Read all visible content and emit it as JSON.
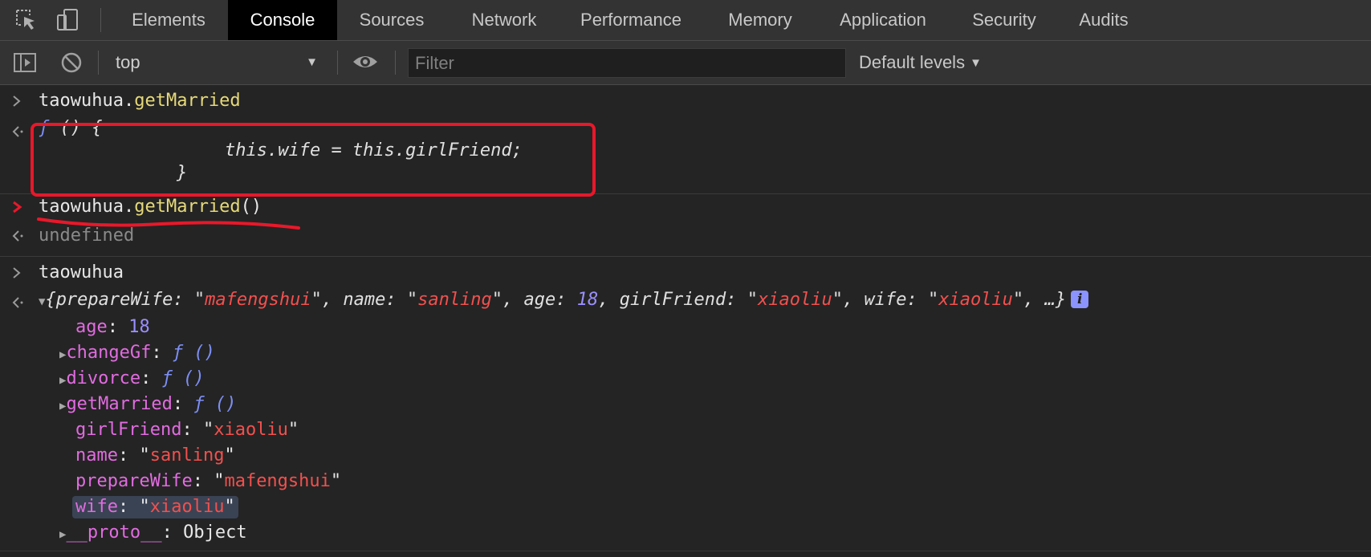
{
  "tabs": [
    {
      "label": "Elements",
      "active": false
    },
    {
      "label": "Console",
      "active": true
    },
    {
      "label": "Sources",
      "active": false
    },
    {
      "label": "Network",
      "active": false
    },
    {
      "label": "Performance",
      "active": false
    },
    {
      "label": "Memory",
      "active": false
    },
    {
      "label": "Application",
      "active": false
    },
    {
      "label": "Security",
      "active": false
    },
    {
      "label": "Audits",
      "active": false
    }
  ],
  "toolbar": {
    "context": "top",
    "filter_placeholder": "Filter",
    "filter_value": "",
    "levels_label": "Default levels"
  },
  "console": {
    "input1": {
      "object": "taowuhua",
      "dot": ".",
      "member": "getMarried"
    },
    "output1": {
      "f": "ƒ",
      "open": " () {",
      "body": "this.wife = this.girlFriend;",
      "close": "}"
    },
    "input2": {
      "object": "taowuhua",
      "dot": ".",
      "member": "getMarried",
      "parens": "()"
    },
    "output2": "undefined",
    "input3": "taowuhua",
    "summary": {
      "open": "{",
      "items": [
        {
          "key": "prepareWife",
          "value": "mafengshui",
          "type": "string"
        },
        {
          "key": "name",
          "value": "sanling",
          "type": "string"
        },
        {
          "key": "age",
          "value": "18",
          "type": "number"
        },
        {
          "key": "girlFriend",
          "value": "xiaoliu",
          "type": "string"
        },
        {
          "key": "wife",
          "value": "xiaoliu",
          "type": "string"
        }
      ],
      "ellipsis": "…}",
      "info": "i"
    },
    "properties": {
      "age": {
        "key": "age",
        "value": "18"
      },
      "changeGf": {
        "key": "changeGf",
        "value": "ƒ ()"
      },
      "divorce": {
        "key": "divorce",
        "value": "ƒ ()"
      },
      "getMarried": {
        "key": "getMarried",
        "value": "ƒ ()"
      },
      "girlFriend": {
        "key": "girlFriend",
        "value": "xiaoliu"
      },
      "name": {
        "key": "name",
        "value": "sanling"
      },
      "prepareWife": {
        "key": "prepareWife",
        "value": "mafengshui"
      },
      "wife": {
        "key": "wife",
        "value": "xiaoliu"
      },
      "proto": {
        "key": "__proto__",
        "value": "Object"
      }
    }
  },
  "colors": {
    "annotation": "#e8182a",
    "panel_bg": "#242424",
    "toolbar_bg": "#333333",
    "string": "#f2504e",
    "key": "#e16ce0",
    "number": "#9a8ffd",
    "function": "#7d8ff5",
    "member": "#e6d97a"
  },
  "icons": [
    "inspect-element-icon",
    "device-toolbar-icon",
    "sidebar-toggle-icon",
    "clear-console-icon",
    "live-expression-eye-icon",
    "prompt-chevron-icon",
    "result-arrow-icon",
    "error-arrow-icon",
    "expand-triangle-icon",
    "info-icon"
  ]
}
